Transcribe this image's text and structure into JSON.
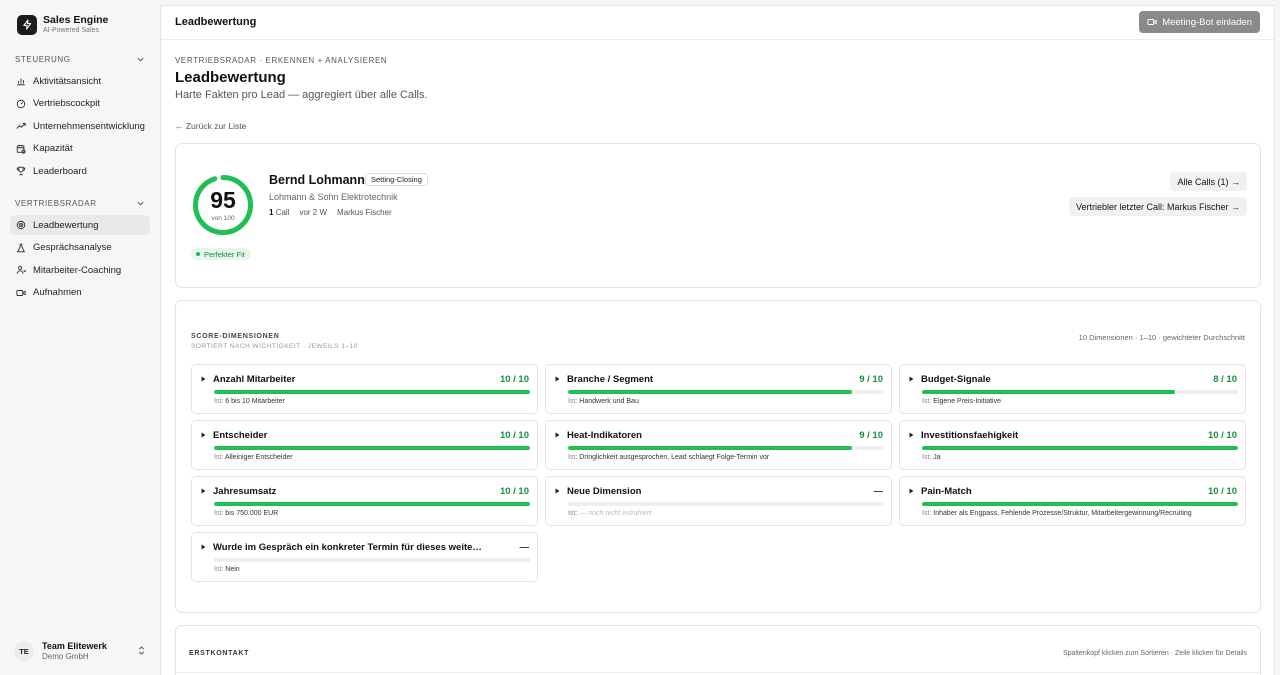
{
  "brand": {
    "name": "Sales Engine",
    "tagline": "AI-Powered Sales"
  },
  "sidebar": {
    "sections": [
      {
        "title": "STEUERUNG",
        "items": [
          {
            "label": "Aktivitätsansicht",
            "icon": "bar-chart-icon"
          },
          {
            "label": "Vertriebscockpit",
            "icon": "gauge-icon"
          },
          {
            "label": "Unternehmensentwicklung",
            "icon": "trending-up-icon"
          },
          {
            "label": "Kapazität",
            "icon": "calendar-clock-icon"
          },
          {
            "label": "Leaderboard",
            "icon": "trophy-icon"
          }
        ]
      },
      {
        "title": "VERTRIEBSRADAR",
        "items": [
          {
            "label": "Leadbewertung",
            "icon": "target-icon",
            "active": true
          },
          {
            "label": "Gesprächsanalyse",
            "icon": "flask-icon"
          },
          {
            "label": "Mitarbeiter-Coaching",
            "icon": "user-coaching-icon"
          },
          {
            "label": "Aufnahmen",
            "icon": "video-icon"
          }
        ]
      }
    ],
    "team": {
      "initials": "TE",
      "name": "Team Elitewerk",
      "org": "Demo GmbH"
    }
  },
  "topbar": {
    "title": "Leadbewertung",
    "invite_label": "Meeting-Bot einladen"
  },
  "page": {
    "breadcrumb": "VERTRIEBSRADAR · ERKENNEN + ANALYSIEREN",
    "title": "Leadbewertung",
    "subtitle": "Harte Fakten pro Lead — aggregiert über alle Calls.",
    "back_link": "← Zurück zur Liste"
  },
  "lead": {
    "score": "95",
    "score_value": 95,
    "score_max": 100,
    "score_of": "von 100",
    "fit_label": "Perfekter Fit",
    "name": "Bernd Lohmann",
    "tag": "Setting-Closing",
    "company": "Lohmann & Sohn Elektrotechnik",
    "calls_count": "1",
    "calls_word": "Call",
    "age": "vor 2 W",
    "owner": "Markus Fischer",
    "all_calls_label": "Alle Calls (1) →",
    "last_call_label": "Vertriebler letzter Call: Markus Fischer →"
  },
  "scores": {
    "heading": "SCORE-DIMENSIONEN",
    "subheading": "SORTIERT NACH WICHTIGKEIT · JEWEILS 1–10",
    "summary": "10 Dimensionen · 1–10 · gewichteter Durchschnitt",
    "ist_label": "Ist:",
    "dimensions": [
      {
        "name": "Anzahl Mitarbeiter",
        "value": "10 / 10",
        "level": 1.0,
        "ist": "6 bis 10 Mitarbeiter"
      },
      {
        "name": "Branche / Segment",
        "value": "9 / 10",
        "level": 0.9,
        "ist": "Handwerk und Bau"
      },
      {
        "name": "Budget-Signale",
        "value": "8 / 10",
        "level": 0.8,
        "ist": "Eigene Preis-Initiative"
      },
      {
        "name": "Entscheider",
        "value": "10 / 10",
        "level": 1.0,
        "ist": "Alleiniger Entscheider"
      },
      {
        "name": "Heat-Indikatoren",
        "value": "9 / 10",
        "level": 0.9,
        "ist": "Dringlichkeit ausgesprochen, Lead schlaegt Folge-Termin vor"
      },
      {
        "name": "Investitionsfaehigkeit",
        "value": "10 / 10",
        "level": 1.0,
        "ist": "Ja"
      },
      {
        "name": "Jahresumsatz",
        "value": "10 / 10",
        "level": 1.0,
        "ist": "bis 750.000 EUR"
      },
      {
        "name": "Neue Dimension",
        "value": "—",
        "level": 0,
        "ist": "— noch nicht extrahiert",
        "empty": true
      },
      {
        "name": "Pain-Match",
        "value": "10 / 10",
        "level": 1.0,
        "ist": "Inhaber als Engpass, Fehlende Prozesse/Struktur, Mitarbeitergewinnung/Recruiting"
      },
      {
        "name": "Wurde im Gespräch ein konkreter Termin für dieses weiterführende Ver...",
        "value": "—",
        "level": 0,
        "ist": "Nein"
      }
    ]
  },
  "erstkontakt": {
    "title": "ERSTKONTAKT",
    "hint": "Spaltenkopf klicken zum Sortieren · Zeile klicken für Details"
  }
}
